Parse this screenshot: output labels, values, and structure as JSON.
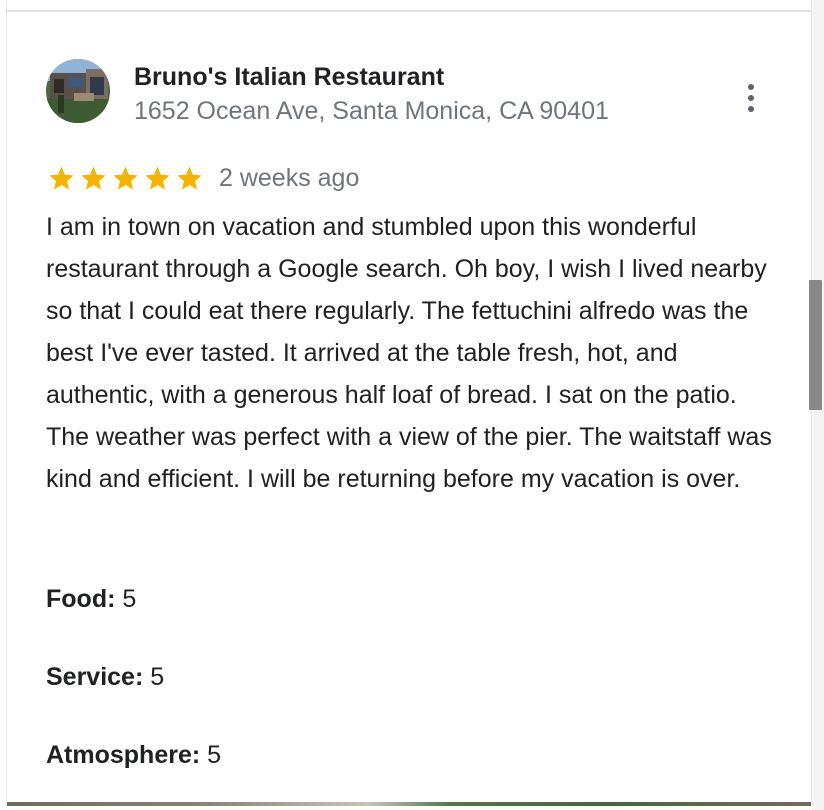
{
  "review": {
    "place_name": "Bruno's Italian Restaurant",
    "place_address": "1652 Ocean Ave, Santa Monica, CA 90401",
    "rating": 5,
    "rating_max": 5,
    "date": "2 weeks ago",
    "text": "I am in town on vacation and stumbled upon this wonderful restaurant through a Google search. Oh boy, I wish I lived nearby so that I could eat there regularly. The fettuchini alfredo was the best I've ever tasted. It arrived at the table fresh, hot, and authentic, with a generous half loaf of bread. I sat on the patio. The weather was perfect with a view of the pier. The waitstaff was kind and efficient. I will be returning before my vacation is over.",
    "attributes": {
      "food_label": "Food:",
      "food_value": "5",
      "service_label": "Service:",
      "service_value": "5",
      "atmosphere_label": "Atmosphere:",
      "atmosphere_value": "5"
    }
  },
  "icons": {
    "menu": "more-vert-icon",
    "star": "star-icon"
  },
  "colors": {
    "star": "#f4b400",
    "text_primary": "#202124",
    "text_secondary": "#70757a"
  }
}
